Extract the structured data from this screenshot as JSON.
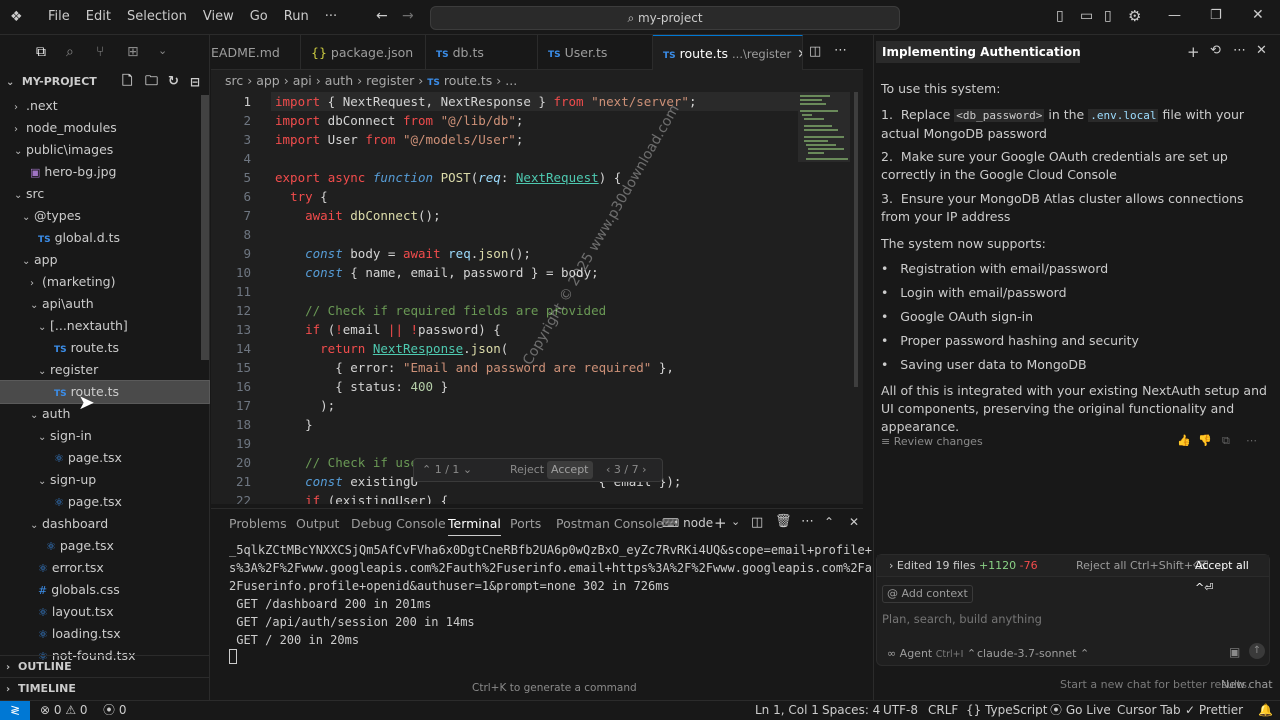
{
  "titlebar": {
    "menus": [
      "File",
      "Edit",
      "Selection",
      "View",
      "Go",
      "Run"
    ],
    "more": "···",
    "search_text": "my-project"
  },
  "explorer": {
    "title": "MY-PROJECT",
    "items": [
      {
        "label": ".next",
        "type": "folder",
        "open": false
      },
      {
        "label": "node_modules",
        "type": "folder",
        "open": false
      },
      {
        "label": "public\\images",
        "type": "folder",
        "open": true
      },
      {
        "label": "hero-bg.jpg",
        "type": "image"
      },
      {
        "label": "src",
        "type": "folder",
        "open": true
      },
      {
        "label": "@types",
        "type": "folder",
        "open": true
      },
      {
        "label": "global.d.ts",
        "type": "ts"
      },
      {
        "label": "app",
        "type": "folder",
        "open": true
      },
      {
        "label": "(marketing)",
        "type": "folder",
        "open": false
      },
      {
        "label": "api\\auth",
        "type": "folder",
        "open": true
      },
      {
        "label": "[...nextauth]",
        "type": "folder",
        "open": true
      },
      {
        "label": "route.ts",
        "type": "ts"
      },
      {
        "label": "register",
        "type": "folder",
        "open": true
      },
      {
        "label": "route.ts",
        "type": "ts"
      },
      {
        "label": "auth",
        "type": "folder",
        "open": true
      },
      {
        "label": "sign-in",
        "type": "folder",
        "open": true
      },
      {
        "label": "page.tsx",
        "type": "tsx"
      },
      {
        "label": "sign-up",
        "type": "folder",
        "open": true
      },
      {
        "label": "page.tsx",
        "type": "tsx"
      },
      {
        "label": "dashboard",
        "type": "folder",
        "open": true
      },
      {
        "label": "page.tsx",
        "type": "tsx"
      },
      {
        "label": "error.tsx",
        "type": "tsx"
      },
      {
        "label": "globals.css",
        "type": "css"
      },
      {
        "label": "layout.tsx",
        "type": "tsx"
      },
      {
        "label": "loading.tsx",
        "type": "tsx"
      },
      {
        "label": "not-found.tsx",
        "type": "tsx"
      }
    ],
    "outline": "OUTLINE",
    "timeline": "TIMELINE"
  },
  "tabs": [
    "EADME.md",
    "package.json",
    "db.ts",
    "User.ts",
    "route.ts"
  ],
  "active_tab_hint": "...\\register",
  "breadcrumb": [
    "src",
    "app",
    "api",
    "auth",
    "register",
    "route.ts",
    "..."
  ],
  "inline_diff": {
    "nav": "1 / 1",
    "reject": "Reject",
    "accept": "Accept",
    "count": "3 / 7"
  },
  "panel": {
    "tabs": [
      "Problems",
      "Output",
      "Debug Console",
      "Terminal",
      "Ports",
      "Postman Console"
    ],
    "active": "Terminal",
    "shell": "node",
    "lines": [
      "_5qlkZCtMBcYNXXCSjQm5AfCvFVha6x0DgtCneRBfb2UA6p0wQzBxO_eyZc7RvRKi4UQ&scope=email+profile+http",
      "s%3A%2F%2Fwww.googleapis.com%2Fauth%2Fuserinfo.email+https%3A%2F%2Fwww.googleapis.com%2Fauth%",
      "2Fuserinfo.profile+openid&authuser=1&prompt=none 302 in 726ms",
      " GET /dashboard 200 in 201ms",
      " GET /api/auth/session 200 in 14ms",
      " GET / 200 in 20ms"
    ],
    "hint": "Ctrl+K to generate a command"
  },
  "chat": {
    "title": "Implementing Authentication for Thi",
    "intro": "To use this system:",
    "steps": [
      [
        "Replace ",
        "<db_password>",
        " in the ",
        ".env.local",
        " file with your actual MongoDB password"
      ],
      [
        "Make sure your Google OAuth credentials are set up correctly in the Google Cloud Console"
      ],
      [
        "Ensure your MongoDB Atlas cluster allows connections from your IP address"
      ]
    ],
    "supports_title": "The system now supports:",
    "supports": [
      "Registration with email/password",
      "Login with email/password",
      "Google OAuth sign-in",
      "Proper password hashing and security",
      "Saving user data to MongoDB"
    ],
    "summary": "All of this is integrated with your existing NextAuth setup and UI components, preserving the original functionality and appearance.",
    "review": "Review changes",
    "edited": "Edited 19 files",
    "added": "+1120",
    "removed": "-76",
    "reject_all": "Reject all Ctrl+Shift+⌫",
    "accept_all": "Accept all ^⏎",
    "add_context": "Add context",
    "placeholder": "Plan, search, build anything",
    "agent": "Agent",
    "agent_shortcut": "Ctrl+I",
    "model": "claude-3.7-sonnet",
    "footer_hint": "Start a new chat for better results.",
    "new_chat": "New chat"
  },
  "status": {
    "errors": "0",
    "warnings": "0",
    "ports": "0",
    "position": "Ln 1, Col 1",
    "spaces": "Spaces: 4",
    "encoding": "UTF-8",
    "eol": "CRLF",
    "lang": "TypeScript",
    "golive": "Go Live",
    "cursortab": "Cursor Tab",
    "prettier": "Prettier"
  },
  "watermark": "Copyright © 2025 www.p30download.com"
}
